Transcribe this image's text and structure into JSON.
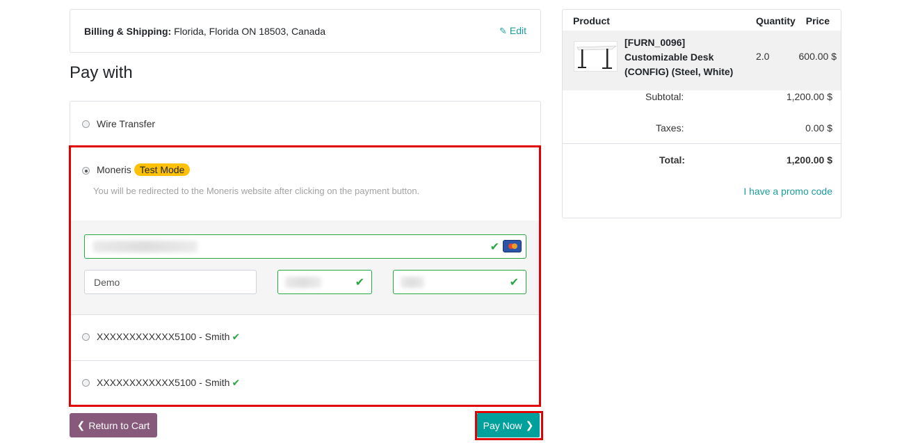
{
  "billing": {
    "label": "Billing & Shipping:",
    "address": "Florida, Florida ON 18503, Canada",
    "edit_label": "Edit"
  },
  "pay_with": {
    "title": "Pay with",
    "options": [
      {
        "label": "Wire Transfer",
        "selected": false
      },
      {
        "label": "Moneris",
        "badge": "Test Mode",
        "selected": true,
        "hint": "You will be redirected to the Moneris website after clicking on the payment button."
      },
      {
        "label": "XXXXXXXXXXXX5100 - Smith",
        "selected": false
      },
      {
        "label": "XXXXXXXXXXXX5100 - Smith",
        "selected": false
      }
    ],
    "card_form": {
      "name_value": "Demo"
    }
  },
  "buttons": {
    "return_label": "Return to Cart",
    "pay_label": "Pay Now"
  },
  "summary": {
    "headers": {
      "product": "Product",
      "quantity": "Quantity",
      "price": "Price"
    },
    "item": {
      "name": "[FURN_0096] Customizable Desk (CONFIG) (Steel, White)",
      "quantity": "2.0",
      "price": "600.00 $"
    },
    "subtotal_label": "Subtotal:",
    "subtotal_value": "1,200.00 $",
    "taxes_label": "Taxes:",
    "taxes_value": "0.00 $",
    "total_label": "Total:",
    "total_value": "1,200.00 $",
    "promo_label": "I have a promo code"
  },
  "colors": {
    "accent": "#00a09d",
    "secondary": "#875a7b",
    "success": "#28a745",
    "warning": "#ffc107",
    "highlight": "#e00000"
  },
  "icons": [
    "edit-icon",
    "chevron-left-icon",
    "chevron-right-icon",
    "check-icon",
    "credit-card-icon"
  ]
}
